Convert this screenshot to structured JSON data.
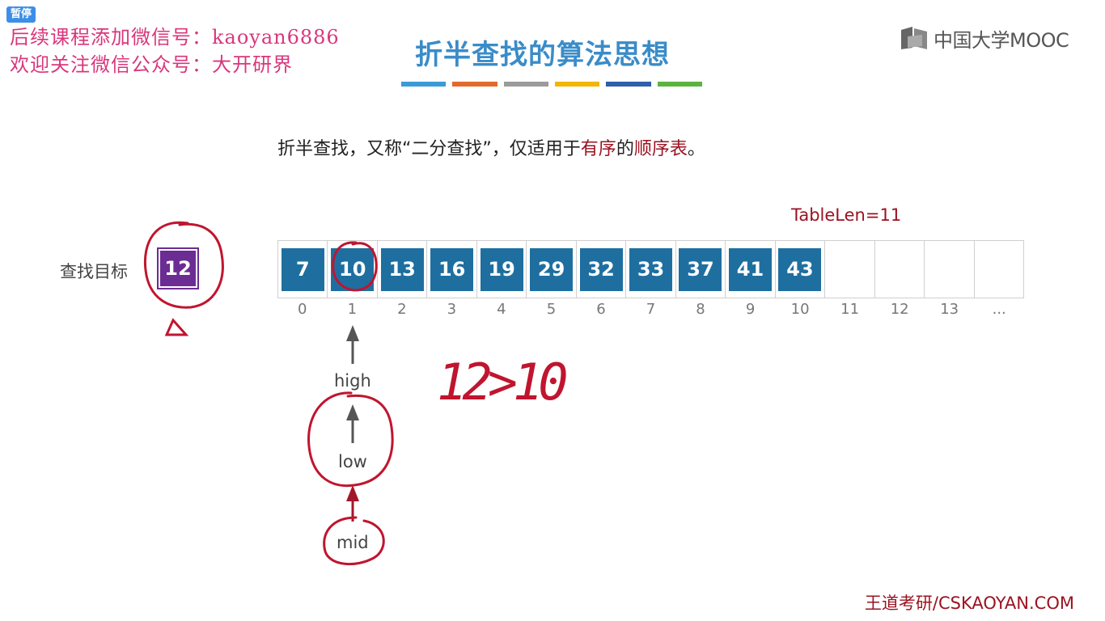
{
  "pause_badge": "暂停",
  "watermark": {
    "line1": "后续课程添加微信号：kaoyan6886",
    "line2": "欢迎关注微信公众号：大开研界"
  },
  "slide_title": "折半查找的算法思想",
  "title_bar_colors": [
    "#3a9bd6",
    "#e36a2c",
    "#9b9b9b",
    "#f2b705",
    "#2d5fab",
    "#5cb33e"
  ],
  "logo_text": "中国大学MOOC",
  "description": {
    "part1": "折半查找，又称“二分查找”，仅适用于",
    "highlight1": "有序",
    "part2": "的",
    "highlight2": "顺序表",
    "part3": "。"
  },
  "table_len_label": "TableLen=11",
  "target": {
    "label": "查找目标",
    "value": "12"
  },
  "array": {
    "values": [
      "7",
      "10",
      "13",
      "16",
      "19",
      "29",
      "32",
      "33",
      "37",
      "41",
      "43",
      "",
      "",
      "",
      ""
    ],
    "indices": [
      "0",
      "1",
      "2",
      "3",
      "4",
      "5",
      "6",
      "7",
      "8",
      "9",
      "10",
      "11",
      "12",
      "13",
      "..."
    ]
  },
  "pointers": {
    "high": "high",
    "low": "low",
    "mid": "mid"
  },
  "annotation_text": "12>10",
  "footer_brand": "王道考研/CSKAOYAN.COM",
  "colors": {
    "cell_fill": "#1e6fa0",
    "target_fill": "#6b2c93",
    "highlight_red": "#9b1221",
    "title_blue": "#3a8cc8",
    "watermark_pink": "#d8377c",
    "ink_red": "#c0152f"
  }
}
